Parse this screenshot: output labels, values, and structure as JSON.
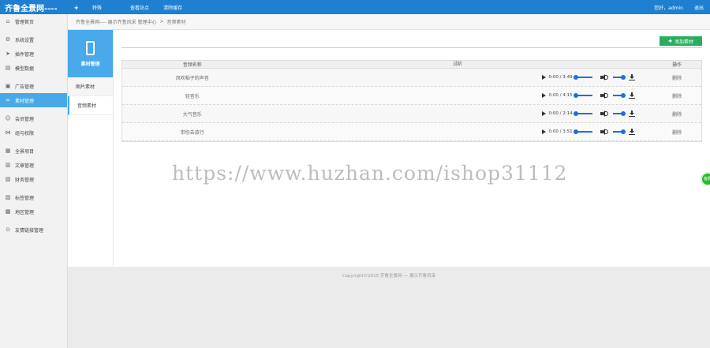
{
  "topbar": {
    "brand": "齐鲁全景网----",
    "nav": [
      "特殊",
      "查看站点",
      "清除缓存"
    ],
    "welcome": "您好，admin",
    "logout": "退出"
  },
  "sidebar": {
    "items": [
      {
        "label": "管理首页",
        "icon": "home-icon"
      },
      {
        "label": "系统设置",
        "icon": "gear-icon"
      },
      {
        "label": "插件管理",
        "icon": "send-icon"
      },
      {
        "label": "模型数据",
        "icon": "book-icon"
      },
      {
        "label": "广告管理",
        "icon": "image-icon"
      },
      {
        "label": "素材管理",
        "icon": "link-icon"
      },
      {
        "label": "会员管理",
        "icon": "user-icon"
      },
      {
        "label": "组与权限",
        "icon": "share-icon"
      },
      {
        "label": "全景项目",
        "icon": "grid-icon"
      },
      {
        "label": "文章管理",
        "icon": "doc-icon"
      },
      {
        "label": "财务管理",
        "icon": "wallet-icon"
      },
      {
        "label": "标签管理",
        "icon": "tag-icon"
      },
      {
        "label": "地区管理",
        "icon": "map-icon"
      },
      {
        "label": "友情链接管理",
        "icon": "chain-icon"
      }
    ],
    "active_index": 5
  },
  "breadcrumb": [
    "齐鲁全景网---- 展示齐鲁风采 管理中心",
    ">",
    "音频素材"
  ],
  "subnav": {
    "title": "素材管理",
    "items": [
      "图片素材",
      "音频素材"
    ]
  },
  "main": {
    "add_label": "添加素材",
    "columns": [
      "音频名称",
      "试听",
      "操作"
    ],
    "rows": [
      {
        "name": "风吹稻子的声音",
        "time": "0:00 / 3:49",
        "action": "删除"
      },
      {
        "name": "轻音乐",
        "time": "0:00 / 4:15",
        "action": "删除"
      },
      {
        "name": "大气音乐",
        "time": "0:00 / 2:14",
        "action": "删除"
      },
      {
        "name": "带你去旅行",
        "time": "0:00 / 3:51",
        "action": "删除"
      }
    ]
  },
  "footer": "Copyright©2015   齐鲁全景网---- 展示齐鲁风采",
  "watermark": "https://www.huzhan.com/ishop31112",
  "float_label": "客服"
}
